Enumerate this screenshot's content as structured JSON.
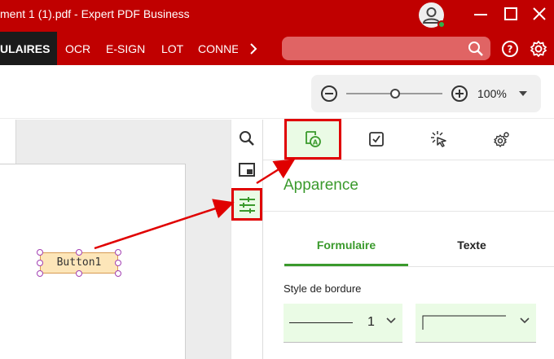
{
  "window": {
    "title": "ment 1 (1).pdf   -   Expert PDF Business",
    "minimize_icon": "minimize-icon",
    "maximize_icon": "maximize-icon",
    "close_icon": "close-icon",
    "account_status_color": "#2fb14a"
  },
  "ribbon": {
    "tabs": [
      {
        "label": "ULAIRES",
        "active": true
      },
      {
        "label": "OCR"
      },
      {
        "label": "E-SIGN"
      },
      {
        "label": "LOT"
      },
      {
        "label": "CONNE"
      }
    ],
    "more_icon": "chevron-right-icon",
    "search_icon": "search-icon",
    "help_icon": "question-icon",
    "settings_icon": "gear-icon"
  },
  "zoom": {
    "value_label": "100%",
    "level": 0.5
  },
  "document": {
    "button_label": "Button1"
  },
  "side_tools": [
    "search-icon",
    "page-icon",
    "sliders-icon"
  ],
  "panel": {
    "tabs": [
      "appearance-icon",
      "checkbox-icon",
      "cursor-click-icon",
      "gear-icon"
    ],
    "title": "Apparence",
    "subtabs": [
      {
        "label": "Formulaire",
        "active": true
      },
      {
        "label": "Texte"
      }
    ],
    "border_style_label": "Style de bordure",
    "border_width_value": "1",
    "accent": "#3a9a2c",
    "highlight": "#e00000"
  }
}
